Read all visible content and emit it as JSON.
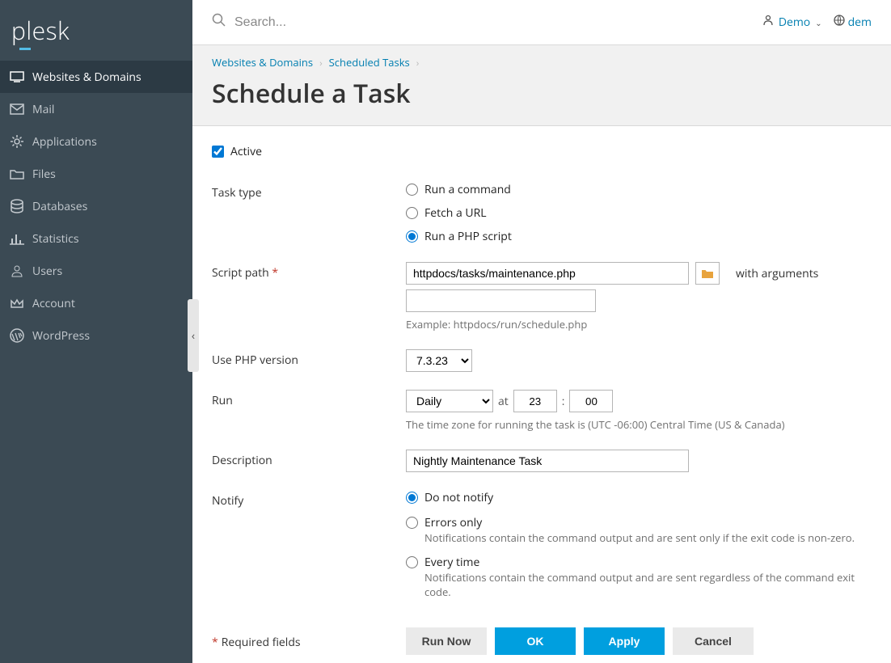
{
  "brand": "plesk",
  "search": {
    "placeholder": "Search..."
  },
  "top_user": "Demo",
  "top_lang": "dem",
  "sidebar": {
    "items": [
      {
        "label": "Websites & Domains"
      },
      {
        "label": "Mail"
      },
      {
        "label": "Applications"
      },
      {
        "label": "Files"
      },
      {
        "label": "Databases"
      },
      {
        "label": "Statistics"
      },
      {
        "label": "Users"
      },
      {
        "label": "Account"
      },
      {
        "label": "WordPress"
      }
    ]
  },
  "breadcrumb": {
    "a": "Websites & Domains",
    "b": "Scheduled Tasks"
  },
  "page_title": "Schedule a Task",
  "form": {
    "active_label": "Active",
    "task_type_label": "Task type",
    "task_type_options": {
      "cmd": "Run a command",
      "url": "Fetch a URL",
      "php": "Run a PHP script"
    },
    "script_path_label": "Script path",
    "script_path_value": "httpdocs/tasks/maintenance.php",
    "with_arguments_label": "with arguments",
    "script_path_hint": "Example: httpdocs/run/schedule.php",
    "php_version_label": "Use PHP version",
    "php_version_value": "7.3.23",
    "run_label": "Run",
    "run_freq": "Daily",
    "run_at_label": "at",
    "run_hour": "23",
    "run_minute": "00",
    "tz_hint": "The time zone for running the task is (UTC -06:00) Central Time (US & Canada)",
    "description_label": "Description",
    "description_value": "Nightly Maintenance Task",
    "notify_label": "Notify",
    "notify_options": {
      "none": "Do not notify",
      "errors": "Errors only",
      "errors_hint": "Notifications contain the command output and are sent only if the exit code is non-zero.",
      "always": "Every time",
      "always_hint": "Notifications contain the command output and are sent regardless of the command exit code."
    },
    "required_note": "Required fields",
    "buttons": {
      "run_now": "Run Now",
      "ok": "OK",
      "apply": "Apply",
      "cancel": "Cancel"
    }
  }
}
